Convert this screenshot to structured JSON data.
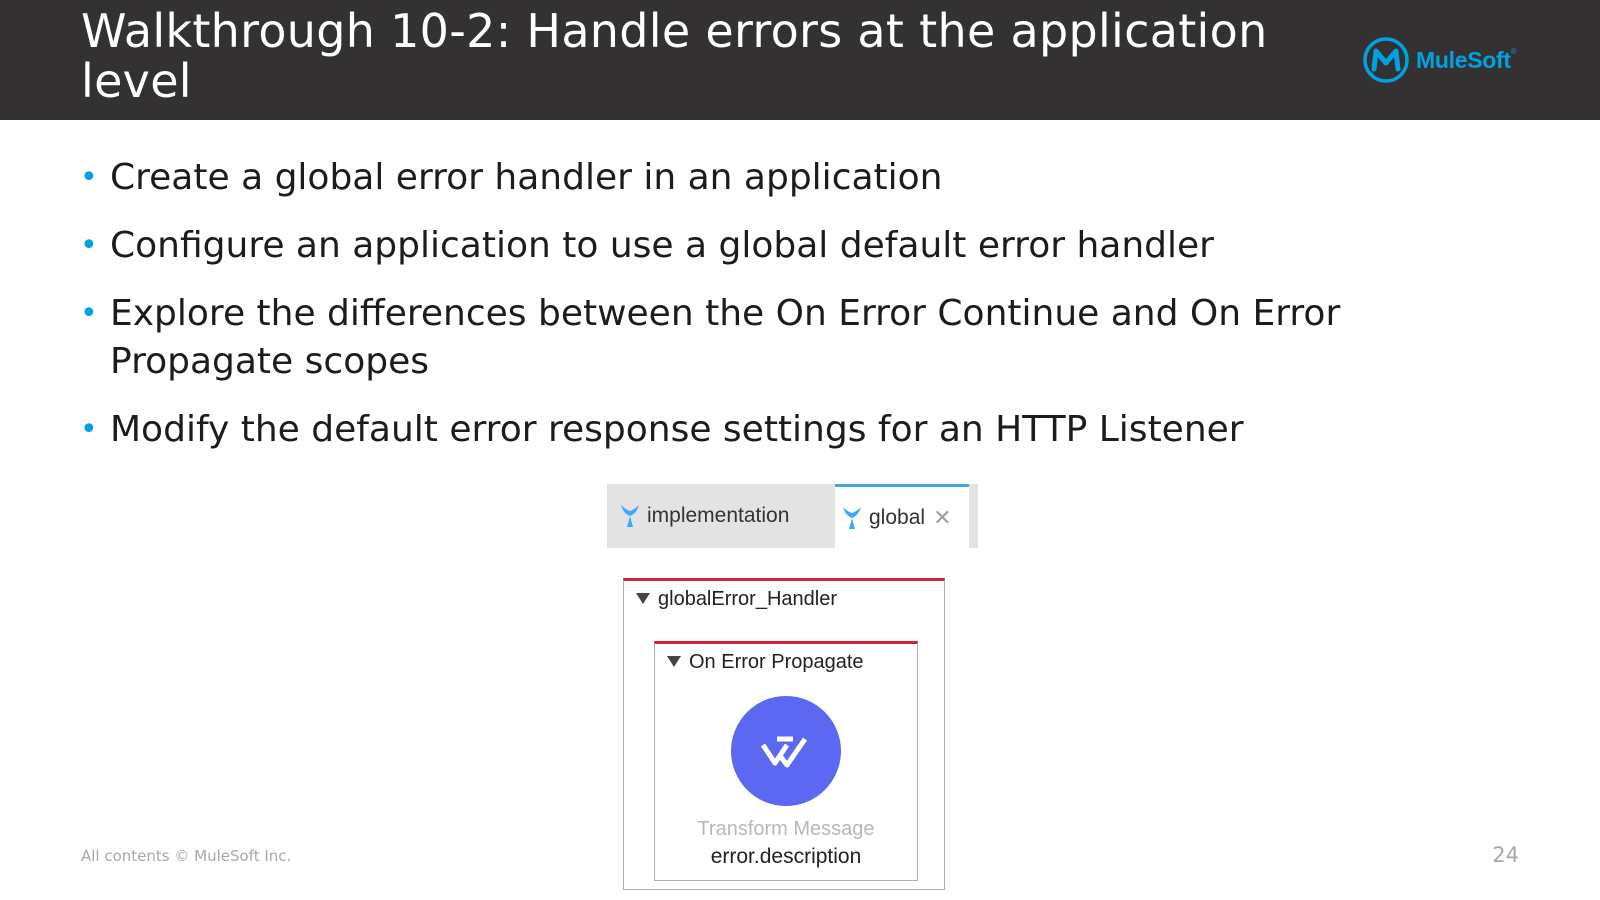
{
  "header": {
    "title": "Walkthrough 10-2: Handle errors at the application level",
    "logo_text": "MuleSoft",
    "logo_icon": "mulesoft-logo-icon",
    "background_color": "#333132",
    "accent_color": "#00a2df"
  },
  "bullets": [
    "Create a global error handler in an application",
    "Configure an application to use a global default error handler",
    "Explore the differences between the On Error Continue and On Error Propagate scopes",
    "Modify the default error response settings for an HTTP Listener"
  ],
  "editor": {
    "tabs": [
      {
        "label": "implementation",
        "active": false,
        "icon": "mule-icon"
      },
      {
        "label": "global",
        "active": true,
        "icon": "mule-icon",
        "closable": true
      }
    ],
    "error_handler": {
      "label": "globalError_Handler",
      "scope": {
        "label": "On Error Propagate",
        "component": {
          "icon": "transform-message-icon",
          "name": "Transform Message",
          "description": "error.description"
        }
      }
    }
  },
  "footer": {
    "copyright": "All contents © MuleSoft Inc.",
    "page_number": "24"
  }
}
